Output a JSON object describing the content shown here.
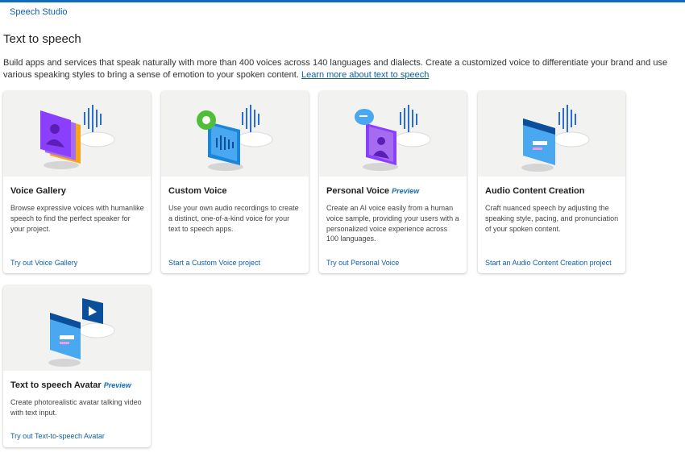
{
  "header": {
    "brand": "Speech Studio"
  },
  "page": {
    "title": "Text to speech",
    "intro": "Build apps and services that speak naturally with more than 400 voices across 140 languages and dialects. Create a customized voice to differentiate your brand and use various speaking styles to bring a sense of emotion to your spoken content.",
    "learn_more": "Learn more about text to speech"
  },
  "cards": [
    {
      "title": "Voice Gallery",
      "badge": "",
      "description": "Browse expressive voices with humanlike speech to find the perfect speaker for your project.",
      "link": "Try out Voice Gallery",
      "icon": "voice-gallery-icon"
    },
    {
      "title": "Custom Voice",
      "badge": "",
      "description": "Use your own audio recordings to create a distinct, one-of-a-kind voice for your text to speech apps.",
      "link": "Start a Custom Voice project",
      "icon": "custom-voice-icon"
    },
    {
      "title": "Personal Voice",
      "badge": "Preview",
      "description": "Create an AI voice easily from a human voice sample, providing your users with a personalized voice experience across 100 languages.",
      "link": "Try out Personal Voice",
      "icon": "personal-voice-icon"
    },
    {
      "title": "Audio Content Creation",
      "badge": "",
      "description": "Craft nuanced speech by adjusting the speaking style, pacing, and pronunciation of your spoken content.",
      "link": "Start an Audio Content Creation project",
      "icon": "audio-content-creation-icon"
    },
    {
      "title": "Text to speech Avatar",
      "badge": "Preview",
      "description": "Create photorealistic avatar talking video with text input.",
      "link": "Try out Text-to-speech Avatar",
      "icon": "text-to-speech-avatar-icon"
    }
  ],
  "colors": {
    "accent": "#0f6cbd",
    "link": "#0f5fa8",
    "card_art_bg": "#f2f2f1",
    "purple": "#8a3ffc",
    "blue": "#1a86d9"
  }
}
